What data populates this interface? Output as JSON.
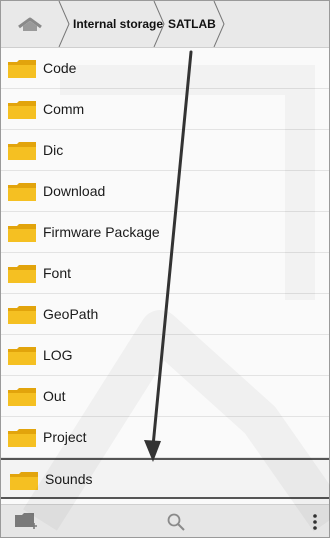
{
  "breadcrumb": {
    "home_icon": "home-icon",
    "items": [
      "Internal storage",
      "SATLAB"
    ]
  },
  "folders": [
    {
      "name": "Code",
      "icon": "folder-icon"
    },
    {
      "name": "Comm",
      "icon": "folder-icon"
    },
    {
      "name": "Dic",
      "icon": "folder-icon"
    },
    {
      "name": "Download",
      "icon": "folder-icon"
    },
    {
      "name": "Firmware Package",
      "icon": "folder-icon"
    },
    {
      "name": "Font",
      "icon": "folder-icon"
    },
    {
      "name": "GeoPath",
      "icon": "folder-icon"
    },
    {
      "name": "LOG",
      "icon": "folder-icon"
    },
    {
      "name": "Out",
      "icon": "folder-icon"
    },
    {
      "name": "Project",
      "icon": "folder-icon"
    },
    {
      "name": "Sounds",
      "icon": "folder-icon",
      "highlighted": true
    }
  ],
  "toolbar": {
    "icons": [
      "new-folder-icon",
      "search-icon",
      "more-icon"
    ]
  },
  "colors": {
    "folder": "#f5c022",
    "folder_dark": "#e2a40c",
    "arrow": "#333333"
  }
}
